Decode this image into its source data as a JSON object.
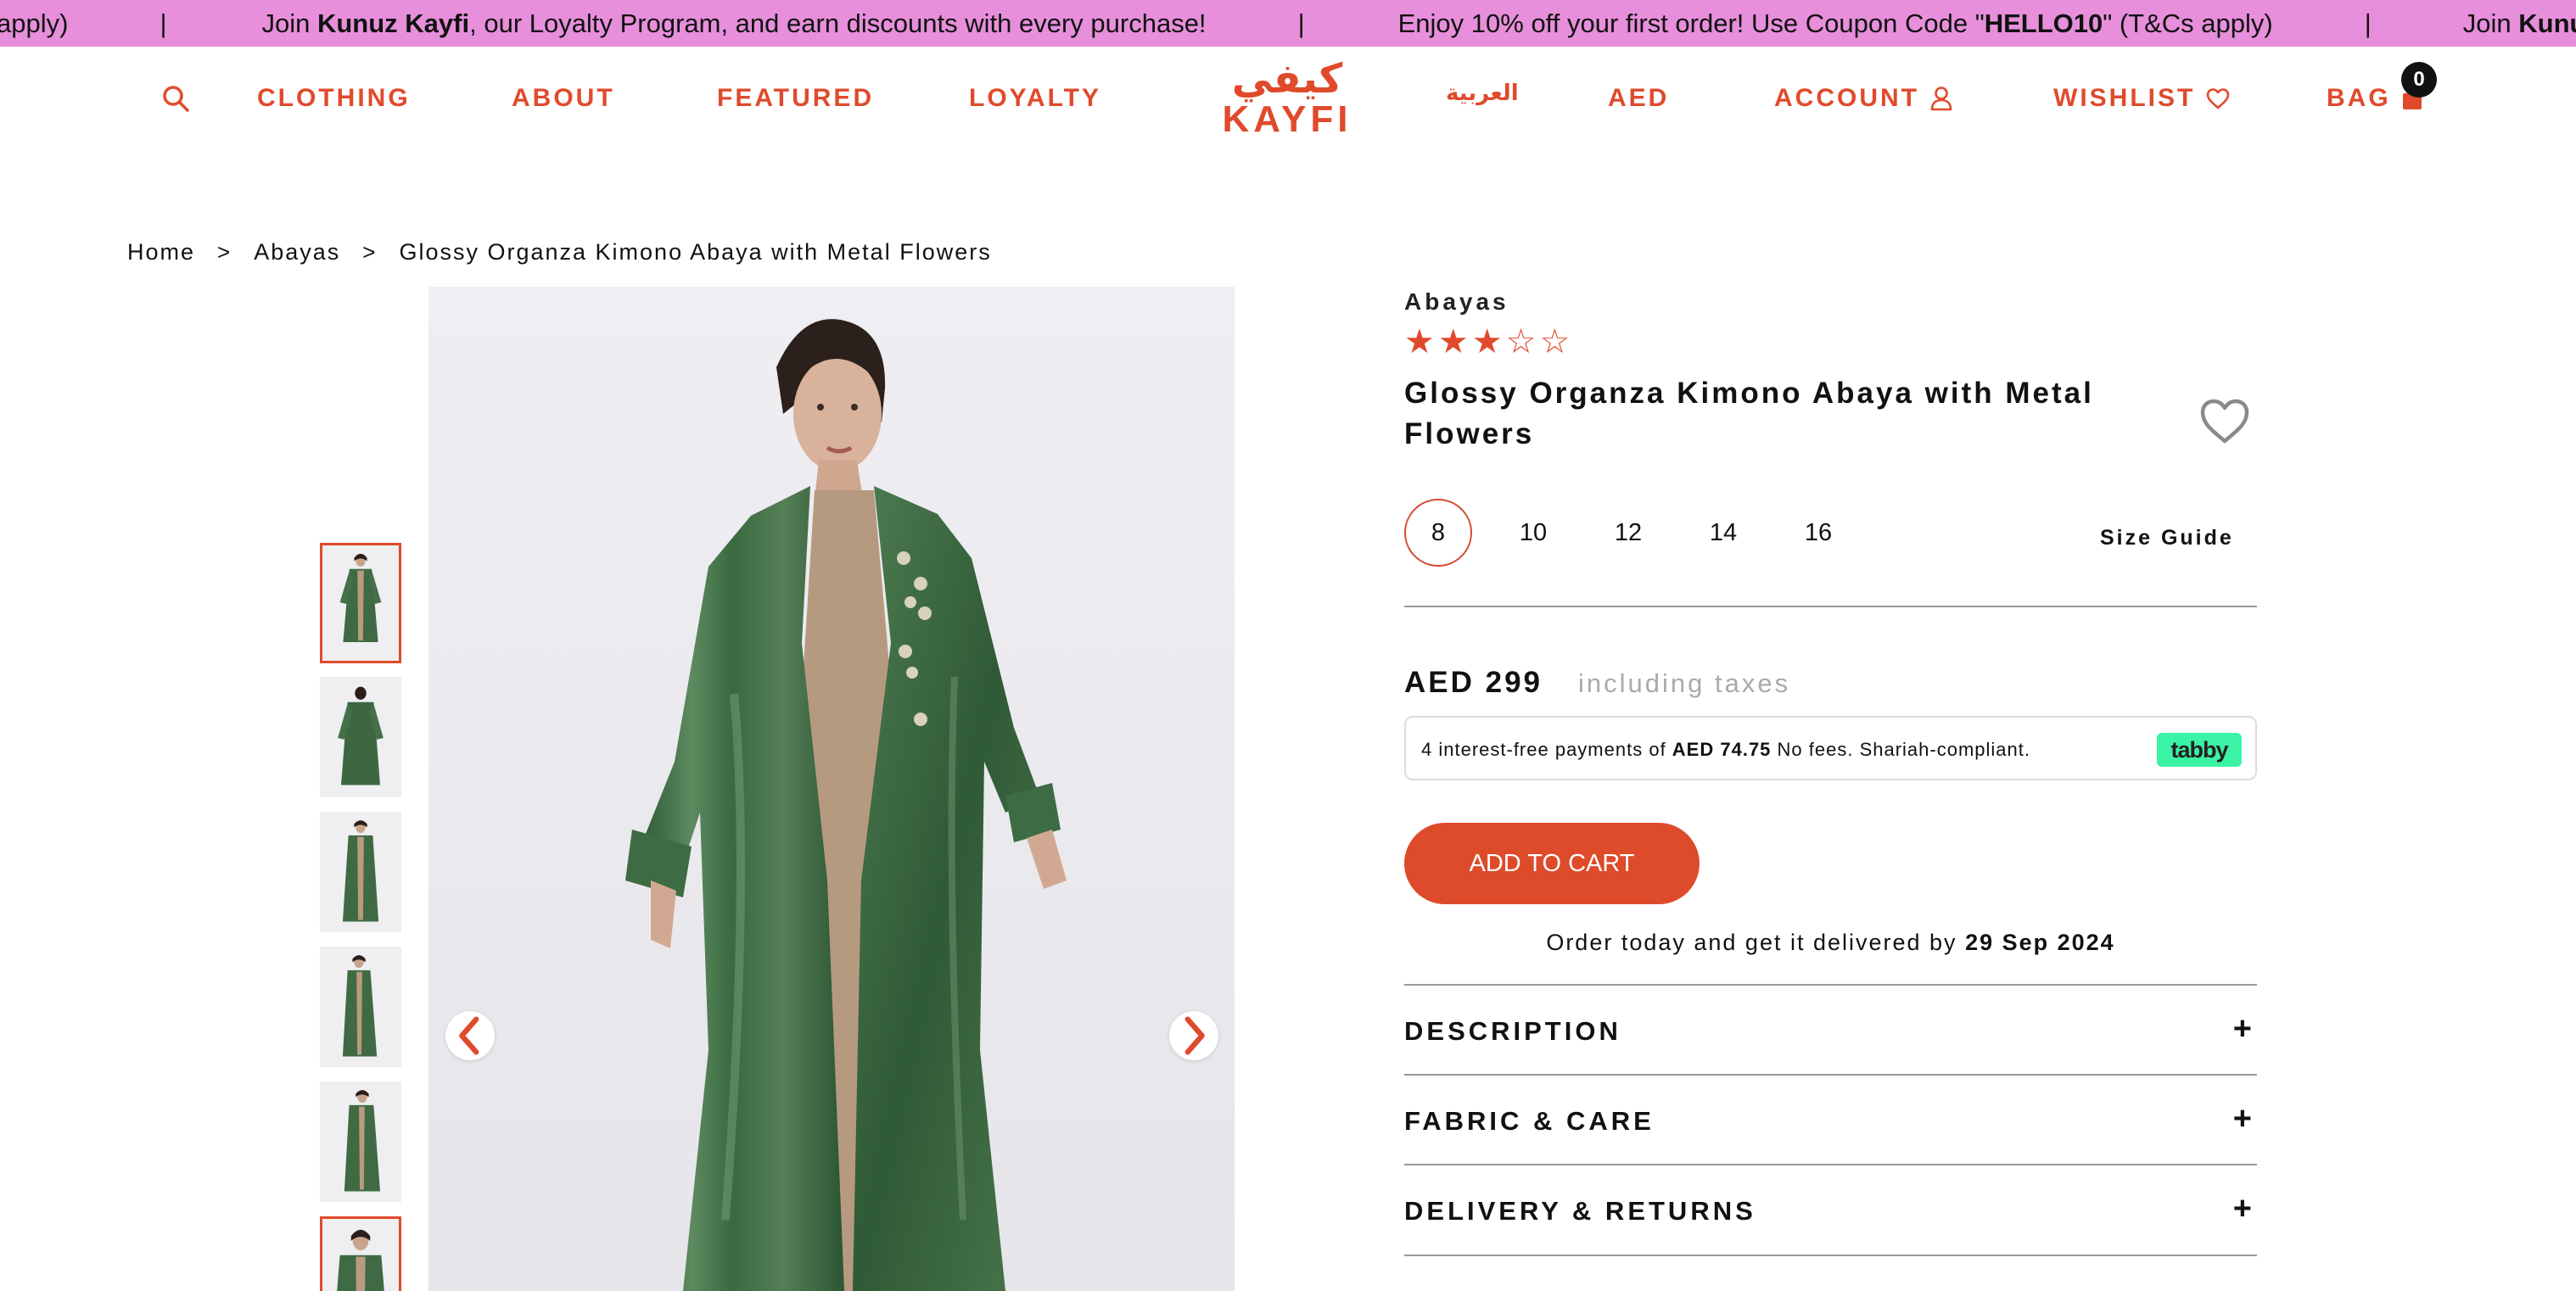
{
  "announcement": {
    "fragment_end": "apply)",
    "separator": "|",
    "loyalty_prefix": "Join ",
    "loyalty_brand": "Kunuz Kayfi",
    "loyalty_suffix": ", our Loyalty Program, and earn discounts with every purchase!",
    "coupon_prefix": "Enjoy 10% off your first order! Use Coupon Code \"",
    "coupon_code": "HELLO10",
    "coupon_suffix": "\" (T&Cs apply)",
    "repeat_start": "Join ",
    "repeat_brand": "Kunuz"
  },
  "header": {
    "nav": {
      "clothing": "CLOTHING",
      "about": "ABOUT",
      "featured": "FEATURED",
      "loyalty": "LOYALTY",
      "arabic": "العربية",
      "currency": "AED",
      "account": "ACCOUNT",
      "wishlist": "WISHLIST",
      "bag": "BAG"
    },
    "logo_arabic": "كيفي",
    "logo_latin": "KAYFI",
    "bag_count": "0",
    "accent_color": "#e04a2c"
  },
  "breadcrumb": {
    "separator": ">",
    "items": [
      "Home",
      "Abayas",
      "Glossy Organza Kimono Abaya with Metal Flowers"
    ]
  },
  "gallery": {
    "thumbnail_count": 6,
    "active_thumbnail": 1
  },
  "product": {
    "category": "Abayas",
    "rating": 3.5,
    "rating_max": 5,
    "title": "Glossy Organza Kimono Abaya with Metal Flowers",
    "sizes": [
      "8",
      "10",
      "12",
      "14",
      "16"
    ],
    "selected_size": "8",
    "size_guide": "Size Guide",
    "price": "AED 299",
    "tax_note": "including taxes",
    "tabby": {
      "text_prefix": "4 interest-free payments of ",
      "amount": "AED 74.75",
      "text_suffix": " No fees. Shariah-compliant.",
      "logo": "tabby"
    },
    "add_to_cart": "ADD TO CART",
    "delivery_prefix": "Order today and get it delivered by ",
    "delivery_date": "29 Sep 2024",
    "accordions": [
      "DESCRIPTION",
      "FABRIC & CARE",
      "DELIVERY & RETURNS"
    ],
    "accordion_icon": "+"
  }
}
